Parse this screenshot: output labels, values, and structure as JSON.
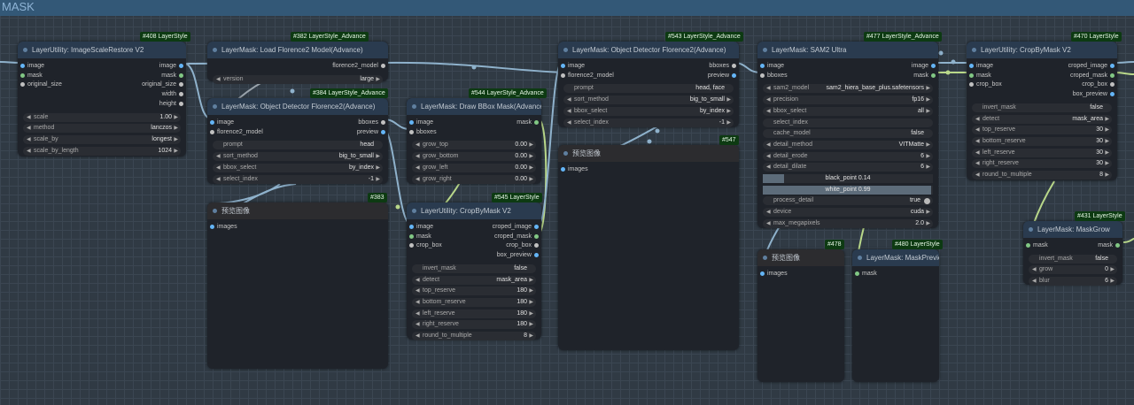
{
  "group": {
    "title": "MASK"
  },
  "nodes": {
    "n408": {
      "badge": "#408 LayerStyle",
      "title": "LayerUtility: ImageScaleRestore V2",
      "inputs": [
        "image",
        "mask",
        "original_size"
      ],
      "outputs": [
        "image",
        "mask",
        "original_size",
        "width",
        "height"
      ],
      "widgets": [
        {
          "label": "scale",
          "value": "1.00"
        },
        {
          "label": "method",
          "value": "lanczos"
        },
        {
          "label": "scale_by",
          "value": "longest"
        },
        {
          "label": "scale_by_length",
          "value": "1024"
        }
      ]
    },
    "n382": {
      "badge": "#382 LayerStyle_Advance",
      "title": "LayerMask: Load Florence2 Model(Advance)",
      "outputs": [
        "florence2_model"
      ],
      "widgets": [
        {
          "label": "version",
          "value": "large"
        }
      ]
    },
    "n384": {
      "badge": "#384 LayerStyle_Advance",
      "title": "LayerMask: Object Detector Florence2(Advance)",
      "inputs": [
        "image",
        "florence2_model"
      ],
      "outputs": [
        "bboxes",
        "preview"
      ],
      "widgets": [
        {
          "label": "prompt",
          "value": "head"
        },
        {
          "label": "sort_method",
          "value": "big_to_small"
        },
        {
          "label": "bbox_select",
          "value": "by_index"
        },
        {
          "label": "select_index",
          "value": "-1"
        }
      ]
    },
    "n544": {
      "badge": "#544 LayerStyle_Advance",
      "title": "LayerMask: Draw BBox Mask(Advance)",
      "inputs": [
        "image",
        "bboxes"
      ],
      "outputs": [
        "mask"
      ],
      "widgets": [
        {
          "label": "grow_top",
          "value": "0.00"
        },
        {
          "label": "grow_bottom",
          "value": "0.00"
        },
        {
          "label": "grow_left",
          "value": "0.00"
        },
        {
          "label": "grow_right",
          "value": "0.00"
        }
      ]
    },
    "n383": {
      "badge": "#383",
      "title": "预览图像",
      "inputs": [
        "images"
      ]
    },
    "n545": {
      "badge": "#545 LayerStyle",
      "title": "LayerUtility: CropByMask V2",
      "inputs": [
        "image",
        "mask",
        "crop_box"
      ],
      "outputs": [
        "croped_image",
        "croped_mask",
        "crop_box",
        "box_preview"
      ],
      "widgets": [
        {
          "label": "invert_mask",
          "value": "false"
        },
        {
          "label": "detect",
          "value": "mask_area"
        },
        {
          "label": "top_reserve",
          "value": "180"
        },
        {
          "label": "bottom_reserve",
          "value": "180"
        },
        {
          "label": "left_reserve",
          "value": "180"
        },
        {
          "label": "right_reserve",
          "value": "180"
        },
        {
          "label": "round_to_multiple",
          "value": "8"
        }
      ]
    },
    "n543": {
      "badge": "#543 LayerStyle_Advance",
      "title": "LayerMask: Object Detector Florence2(Advance)",
      "inputs": [
        "image",
        "florence2_model"
      ],
      "outputs": [
        "bboxes",
        "preview"
      ],
      "widgets": [
        {
          "label": "prompt",
          "value": "head, face"
        },
        {
          "label": "sort_method",
          "value": "big_to_small"
        },
        {
          "label": "bbox_select",
          "value": "by_index"
        },
        {
          "label": "select_index",
          "value": "-1"
        }
      ]
    },
    "n547": {
      "badge": "#547",
      "title": "预览图像",
      "inputs": [
        "images"
      ]
    },
    "n477": {
      "badge": "#477 LayerStyle_Advance",
      "title": "LayerMask: SAM2 Ultra",
      "inputs": [
        "image",
        "bboxes"
      ],
      "outputs": [
        "image",
        "mask"
      ],
      "widgets": [
        {
          "label": "sam2_model",
          "value": "sam2_hiera_base_plus.safetensors"
        },
        {
          "label": "precision",
          "value": "fp16"
        },
        {
          "label": "bbox_select",
          "value": "all"
        },
        {
          "label": "select_index",
          "value": ""
        },
        {
          "label": "cache_model",
          "value": "false"
        },
        {
          "label": "detail_method",
          "value": "VITMatte"
        },
        {
          "label": "detail_erode",
          "value": "6"
        },
        {
          "label": "detail_dilate",
          "value": "6"
        }
      ],
      "black_point": {
        "label": "black_point",
        "value": "0.14",
        "fraction": 0.14
      },
      "white_point": {
        "label": "white_point",
        "value": "0.99",
        "fraction": 0.99
      },
      "widgets2": [
        {
          "label": "process_detail",
          "value": "true"
        },
        {
          "label": "device",
          "value": "cuda"
        },
        {
          "label": "max_megapixels",
          "value": "2.0"
        }
      ]
    },
    "n478": {
      "badge": "#478",
      "title": "预览图像",
      "inputs": [
        "images"
      ]
    },
    "n480": {
      "badge": "#480 LayerStyle",
      "title": "LayerMask: MaskPreview",
      "inputs": [
        "mask"
      ]
    },
    "n470": {
      "badge": "#470 LayerStyle",
      "title": "LayerUtility: CropByMask V2",
      "inputs": [
        "image",
        "mask",
        "crop_box"
      ],
      "outputs": [
        "croped_image",
        "croped_mask",
        "crop_box",
        "box_preview"
      ],
      "widgets": [
        {
          "label": "invert_mask",
          "value": "false"
        },
        {
          "label": "detect",
          "value": "mask_area"
        },
        {
          "label": "top_reserve",
          "value": "30"
        },
        {
          "label": "bottom_reserve",
          "value": "30"
        },
        {
          "label": "left_reserve",
          "value": "30"
        },
        {
          "label": "right_reserve",
          "value": "30"
        },
        {
          "label": "round_to_multiple",
          "value": "8"
        }
      ]
    },
    "n431": {
      "badge": "#431 LayerStyle",
      "title": "LayerMask: MaskGrow",
      "inputs": [
        "mask"
      ],
      "outputs": [
        "mask"
      ],
      "widgets": [
        {
          "label": "invert_mask",
          "value": "false"
        },
        {
          "label": "grow",
          "value": "0"
        },
        {
          "label": "blur",
          "value": "6"
        }
      ]
    }
  },
  "colors": {
    "image": "#64b5f6",
    "mask": "#81c784",
    "other": "#c0c0c0",
    "wire_image": "#8fb2cc",
    "wire_mask": "#b9d88a",
    "badge": "#0d3a12"
  }
}
